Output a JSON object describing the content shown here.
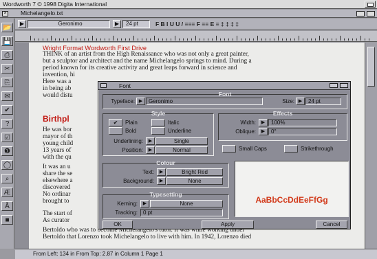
{
  "screen": {
    "title": "Wordworth 7  © 1998 Digita International"
  },
  "document": {
    "title": "Michelangelo.txt",
    "close_glyph": "×"
  },
  "palette": {
    "tools": [
      {
        "name": "open-icon",
        "glyph": "📂"
      },
      {
        "name": "save-icon",
        "glyph": "💾"
      },
      {
        "name": "print-icon",
        "glyph": "⎙"
      },
      {
        "name": "cut-icon",
        "glyph": "✂"
      },
      {
        "name": "copy-icon",
        "glyph": "⎘"
      },
      {
        "name": "paste-icon",
        "glyph": "✉"
      },
      {
        "name": "spell-icon",
        "glyph": "✔"
      },
      {
        "name": "help-icon",
        "glyph": "?"
      },
      {
        "name": "checklist-icon",
        "glyph": "☑"
      },
      {
        "name": "info-icon",
        "glyph": "❶"
      },
      {
        "name": "zoom-icon",
        "glyph": "◯"
      },
      {
        "name": "search-icon",
        "glyph": "⌕"
      },
      {
        "name": "abc-icon",
        "glyph": "Æ"
      },
      {
        "name": "abc-check-icon",
        "glyph": "Å"
      },
      {
        "name": "colour-icon",
        "glyph": "■"
      }
    ]
  },
  "formatbar": {
    "font_value": "Geronimo",
    "size_value": "24 pt",
    "style_glyphs": "F  B  I  U  U  /   ≡≡≡   F  ≡≡   E  ≡   ‡ ‡ ‡ ‡"
  },
  "page": {
    "lines": [
      "Wright Format Wordworth First Drive",
      "THINK of an artist from the High Renaissance who was not only a great painter,",
      "but a sculptor and architect and the name Michelangelo springs to mind. During a",
      "period known for its creative activity and great leaps forward in science and",
      "invention, hi",
      "Here was a",
      "in being ab",
      "would distu"
    ],
    "heading": "Birthpl",
    "lines2": [
      "He was bor",
      "mayor of th",
      "young child",
      "13 years of",
      "with the qu",
      "It was an u",
      "share the se",
      "elsewhere a",
      "discovered",
      "No ordinar",
      "brought to"
    ],
    "lines3": [
      "The start of",
      "As curator",
      "Bertoldo who was to become Michelangelo's tutor. It was while working under",
      "Bertoldo that Lorenzo took Michelangelo to live with him. In 1942, Lorenzo died"
    ]
  },
  "status": {
    "text": "From Left: 134 in    From Top: 2.87 in    Column 1    Page 1"
  },
  "font_dialog": {
    "title": "Font",
    "section_title": "Font",
    "typeface_label": "Typeface:",
    "typeface_value": "Geronimo",
    "size_label": "Size:",
    "size_value": "24 pt",
    "style_title": "Style",
    "plain_label": "Plain",
    "plain_check": "✔",
    "italic_label": "Italic",
    "bold_label": "Bold",
    "underline_label": "Underline",
    "underlining_label": "Underlining:",
    "underlining_value": "Single",
    "position_label": "Position:",
    "position_value": "Normal",
    "effects_title": "Effects",
    "width_label": "Width:",
    "width_value": "100%",
    "oblique_label": "Oblique:",
    "oblique_value": "0°",
    "smallcaps_label": "Small Caps",
    "strike_label": "Strikethrough",
    "colour_title": "Colour",
    "text_label": "Text:",
    "text_value": "Bright Red",
    "background_label": "Background:",
    "background_value": "None",
    "typesetting_title": "Typesetting",
    "kerning_label": "Kerning:",
    "kerning_value": "None",
    "tracking_label": "Tracking:",
    "tracking_value": "0 pt",
    "sample_text": "AaBbCcDdEeFfGg",
    "ok_label": "OK",
    "apply_label": "Apply",
    "cancel_label": "Cancel",
    "popup_glyph": "▶"
  }
}
